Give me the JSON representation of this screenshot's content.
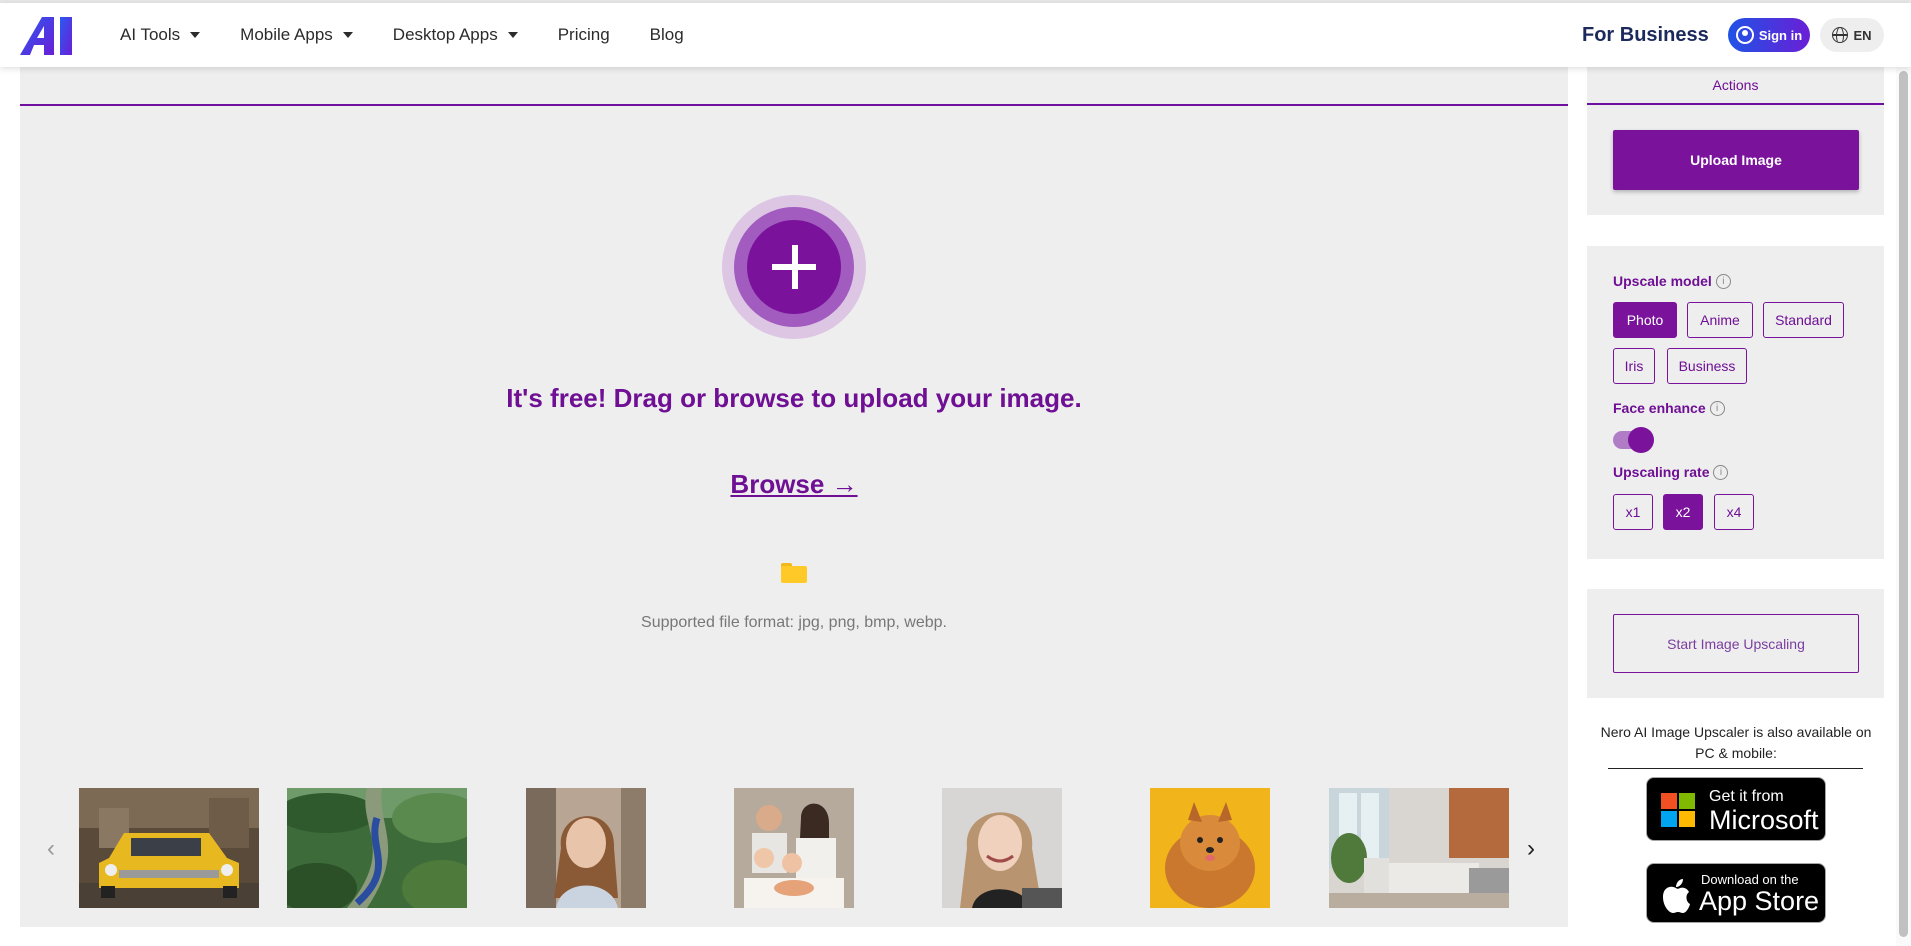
{
  "header": {
    "logo_text": "AI",
    "nav": [
      {
        "label": "AI Tools",
        "dropdown": true
      },
      {
        "label": "Mobile Apps",
        "dropdown": true
      },
      {
        "label": "Desktop Apps",
        "dropdown": true
      },
      {
        "label": "Pricing",
        "dropdown": false
      },
      {
        "label": "Blog",
        "dropdown": false
      }
    ],
    "for_business": "For Business",
    "sign_in": "Sign in",
    "language": "EN"
  },
  "upload": {
    "headline": "It's free! Drag or browse to upload your image.",
    "browse": "Browse →",
    "formats": "Supported file format: jpg, png, bmp, webp."
  },
  "carousel": {
    "prev_icon": "chevron-left-icon",
    "next_icon": "chevron-right-icon",
    "samples": [
      "yellow-car",
      "train-landscape",
      "woman-portrait",
      "family",
      "smiling-woman",
      "pomeranian-dog",
      "living-room"
    ]
  },
  "panel": {
    "actions_tab": "Actions",
    "upload_button": "Upload Image",
    "upscale_model": {
      "label": "Upscale model",
      "options": [
        "Photo",
        "Anime",
        "Standard",
        "Iris",
        "Business"
      ],
      "selected": "Photo"
    },
    "face_enhance": {
      "label": "Face enhance",
      "enabled": true
    },
    "upscaling_rate": {
      "label": "Upscaling rate",
      "options": [
        "x1",
        "x2",
        "x4"
      ],
      "selected": "x2"
    },
    "start_button": "Start Image Upscaling",
    "available_text": "Nero AI Image Upscaler is also available on PC & mobile:",
    "microsoft": {
      "small": "Get it from",
      "big": "Microsoft"
    },
    "appstore": {
      "small": "Download on the",
      "big": "App Store"
    }
  },
  "colors": {
    "brand_purple": "#7a129c",
    "background": "#eeeeee",
    "sign_in_gradient": [
      "#1f53e6",
      "#6a1fd6"
    ]
  }
}
